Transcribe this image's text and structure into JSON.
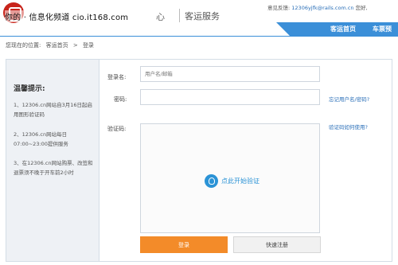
{
  "header": {
    "watermark": "你的 · 信息化频道 cio.it168.com",
    "brand_tail": "心",
    "service_title": "客运服务",
    "feedback_label": "意见反馈:",
    "feedback_email": "12306yjfk@rails.com.cn",
    "greeting": "您好,",
    "nav": {
      "home": "客运首页",
      "ticket": "车票预"
    }
  },
  "breadcrumb": {
    "prefix": "您现在的位置:",
    "home": "客运首页",
    "separator": ">",
    "current": "登录"
  },
  "tips": {
    "title": "温馨提示:",
    "items": [
      "1、12306.cn网站自3月16日起启用图形验证码",
      "2、12306.cn网站每日07:00~23:00提供服务",
      "3、在12306.cn网站购票、改签和退票须不晚于开车前2小时"
    ]
  },
  "form": {
    "username_label": "登录名:",
    "username_placeholder": "用户名/邮箱",
    "password_label": "密码:",
    "forgot_link": "忘记用户名/密码?",
    "captcha_label": "验证码:",
    "captcha_help_link": "验证码如何使用?",
    "captcha_prompt": "点此开始验证",
    "login_button": "登录",
    "register_button": "快速注册"
  },
  "colors": {
    "accent_blue": "#3b8fd8",
    "login_orange": "#f38b29",
    "logo_red": "#c8241b"
  }
}
